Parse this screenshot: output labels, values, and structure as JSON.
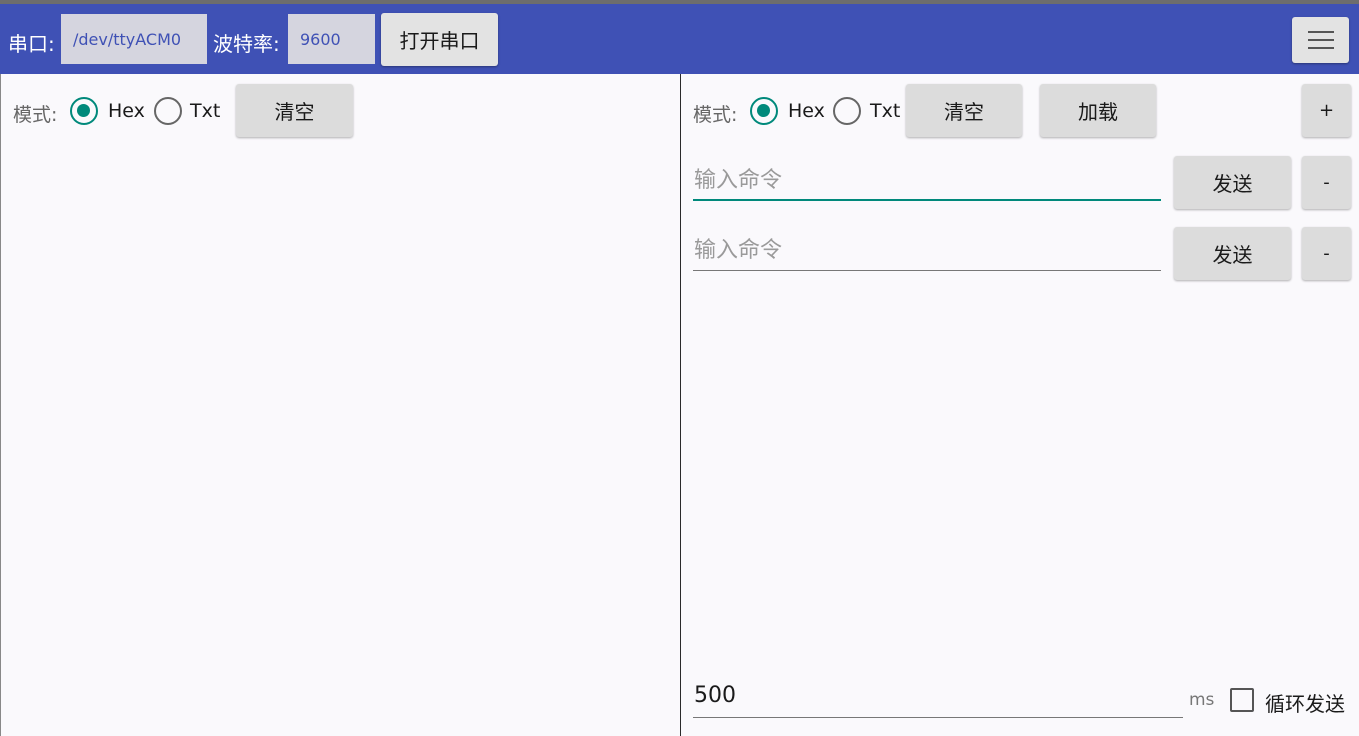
{
  "toolbar": {
    "port_label": "串口:",
    "port_value": "/dev/ttyACM0",
    "baud_label": "波特率:",
    "baud_value": "9600",
    "open_button": "打开串口",
    "menu_icon": "hamburger-menu-icon"
  },
  "receive_panel": {
    "mode_label": "模式:",
    "mode_options": [
      {
        "label": "Hex",
        "checked": true
      },
      {
        "label": "Txt",
        "checked": false
      }
    ],
    "clear_button": "清空"
  },
  "send_panel": {
    "mode_label": "模式:",
    "mode_options": [
      {
        "label": "Hex",
        "checked": true
      },
      {
        "label": "Txt",
        "checked": false
      }
    ],
    "clear_button": "清空",
    "load_button": "加载",
    "add_button": "+",
    "commands": [
      {
        "placeholder": "输入命令",
        "value": "",
        "send_label": "发送",
        "remove_label": "-"
      },
      {
        "placeholder": "输入命令",
        "value": "",
        "send_label": "发送",
        "remove_label": "-"
      }
    ],
    "interval_value": "500",
    "interval_unit": "ms",
    "loop_send_label": "循环发送",
    "loop_send_checked": false
  },
  "colors": {
    "toolbar": "#3f51b5",
    "accent": "#00897b",
    "background": "#faf9fc"
  }
}
